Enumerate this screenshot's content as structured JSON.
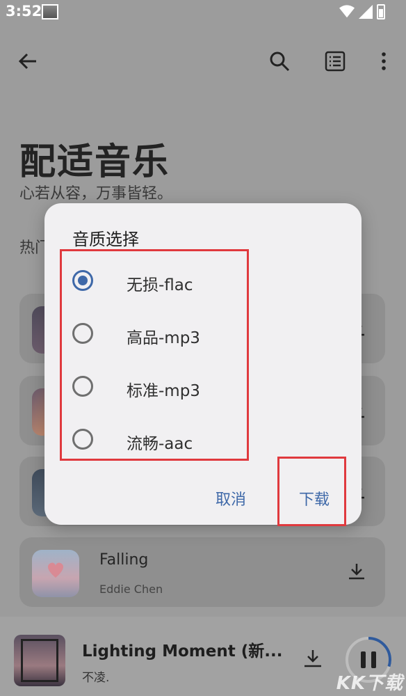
{
  "status_bar": {
    "time": "3:52"
  },
  "header": {
    "title": "配适音乐",
    "subtitle": "心若从容，万事皆轻。",
    "section_label": "热门"
  },
  "songs": [
    {
      "title": "",
      "artist": ""
    },
    {
      "title": "",
      "artist": ""
    },
    {
      "title": "",
      "artist": ""
    },
    {
      "title": "Falling",
      "artist": "Eddie Chen"
    }
  ],
  "now_playing": {
    "title": "Lighting Moment (新...",
    "artist": "不凌.",
    "progress": 0.3
  },
  "dialog": {
    "title": "音质选择",
    "options": [
      "无损-flac",
      "高品-mp3",
      "标准-mp3",
      "流畅-aac"
    ],
    "selected_index": 0,
    "cancel_label": "取消",
    "confirm_label": "下载"
  },
  "watermark": "KK下载",
  "colors": {
    "accent": "#3e68a8",
    "highlight": "#e0393e"
  }
}
